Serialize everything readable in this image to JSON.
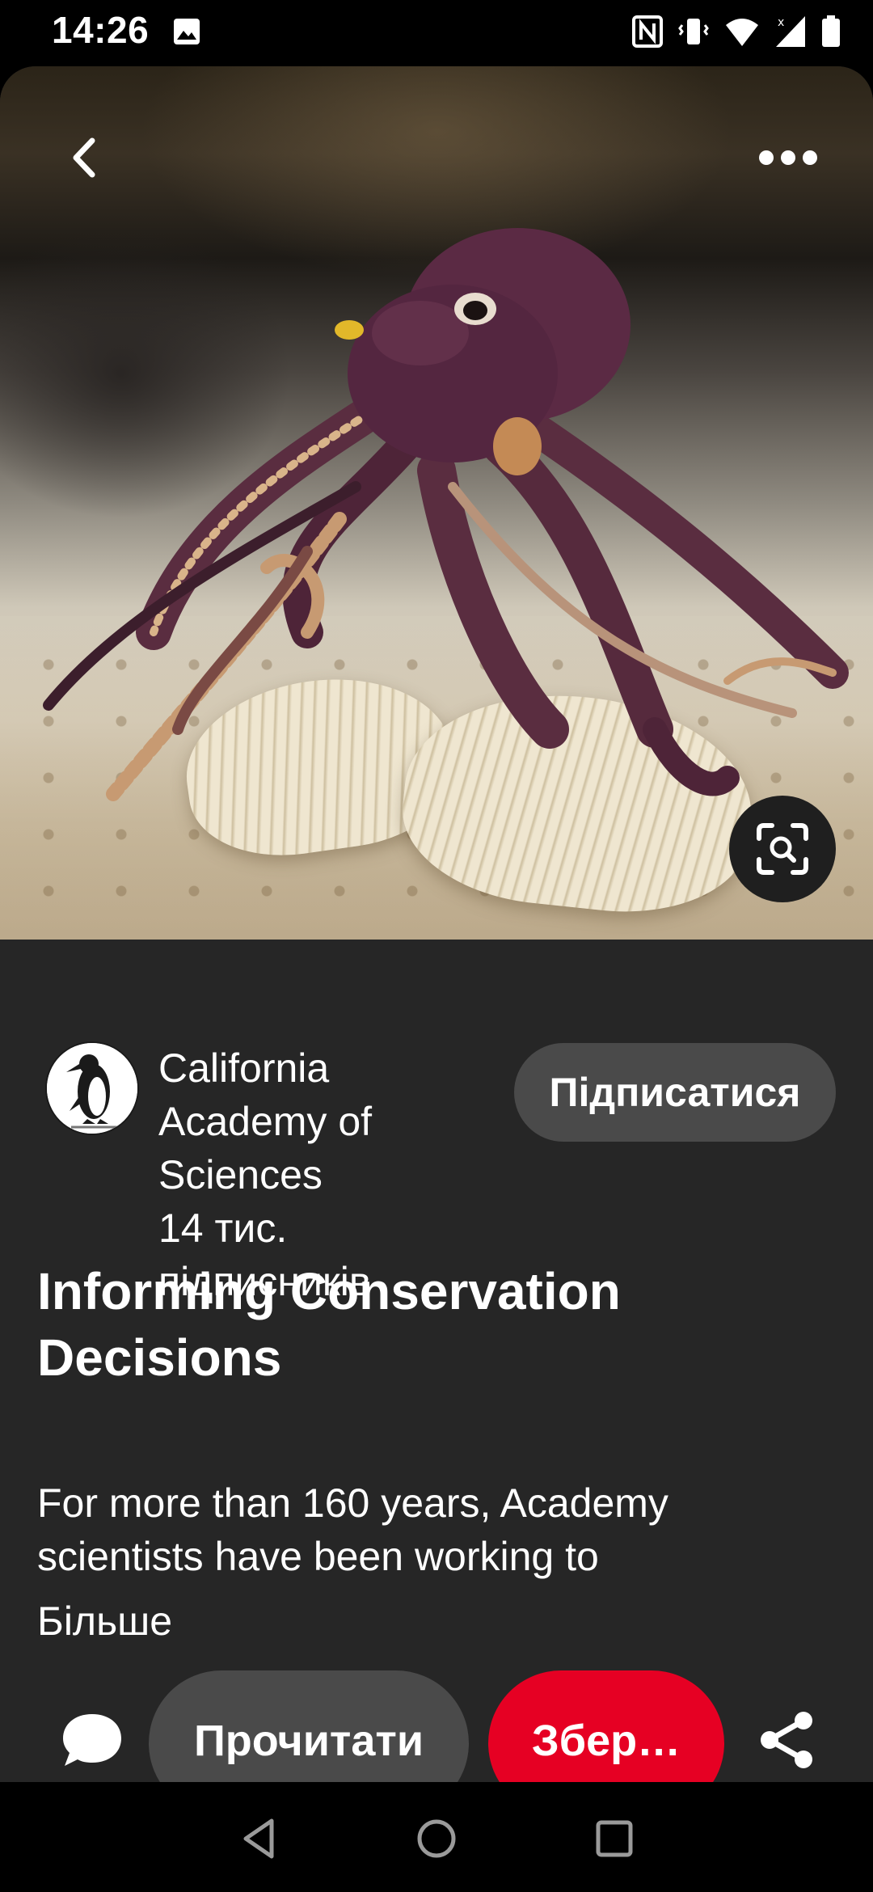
{
  "status_bar": {
    "time": "14:26",
    "left_icons": [
      "image-icon"
    ],
    "right_icons": [
      "nfc-icon",
      "vibrate-icon",
      "wifi-icon",
      "signal-icon",
      "battery-icon"
    ]
  },
  "pin": {
    "icons": {
      "back": "back-arrow-icon",
      "more": "more-options-icon",
      "lens": "visual-search-icon"
    },
    "creator": {
      "name": "California Academy of Sciences",
      "followers": "14 тис. підписників",
      "follow_label": "Підписатися"
    },
    "title": "Informing Conservation Decisions",
    "description": "For more than 160 years, Academy scientists have been working to",
    "more_label": "Більше"
  },
  "actions": {
    "comment_icon": "comment-icon",
    "read_label": "Прочитати",
    "save_label": "Збер…",
    "share_icon": "share-icon"
  },
  "nav_bar": {
    "icons": [
      "back-triangle-icon",
      "home-circle-icon",
      "recents-square-icon"
    ]
  },
  "colors": {
    "background": "#262626",
    "button_gray": "#4a4a4a",
    "save_red": "#e60023",
    "text": "#ffffff"
  }
}
